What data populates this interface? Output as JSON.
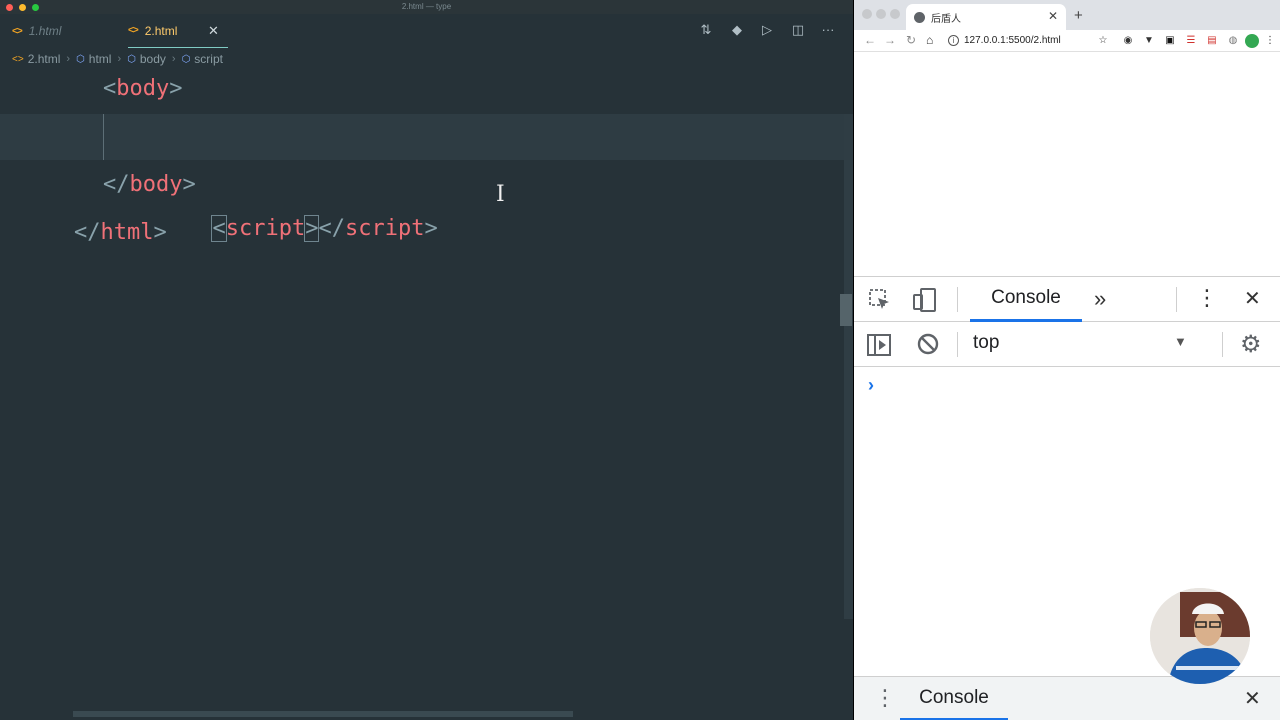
{
  "editor": {
    "window_title": "2.html — type",
    "tabs": [
      {
        "label": "1.html",
        "active": false
      },
      {
        "label": "2.html",
        "active": true
      }
    ],
    "breadcrumb": [
      "2.html",
      "html",
      "body",
      "script"
    ],
    "code_lines": [
      {
        "open": "<",
        "tag": "body",
        "close": ">"
      },
      {
        "open": "<",
        "tag": "script",
        "close": ">",
        "open2": "</",
        "tag2": "script",
        "close2": ">"
      },
      {
        "open": "</",
        "tag": "body",
        "close": ">"
      },
      {
        "open": "</",
        "tag": "html",
        "close": ">"
      }
    ],
    "colors": {
      "background": "#263238",
      "tag": "#f07178",
      "bracket": "#89a2ab",
      "active_tab": "#ffcb6b"
    }
  },
  "browser": {
    "tab_title": "后盾人",
    "url": "127.0.0.1:5500/2.html",
    "devtools": {
      "main_tab": "Console",
      "more_tabs_glyph": "»",
      "context": "top",
      "prompt": "›",
      "drawer_tab": "Console"
    }
  }
}
